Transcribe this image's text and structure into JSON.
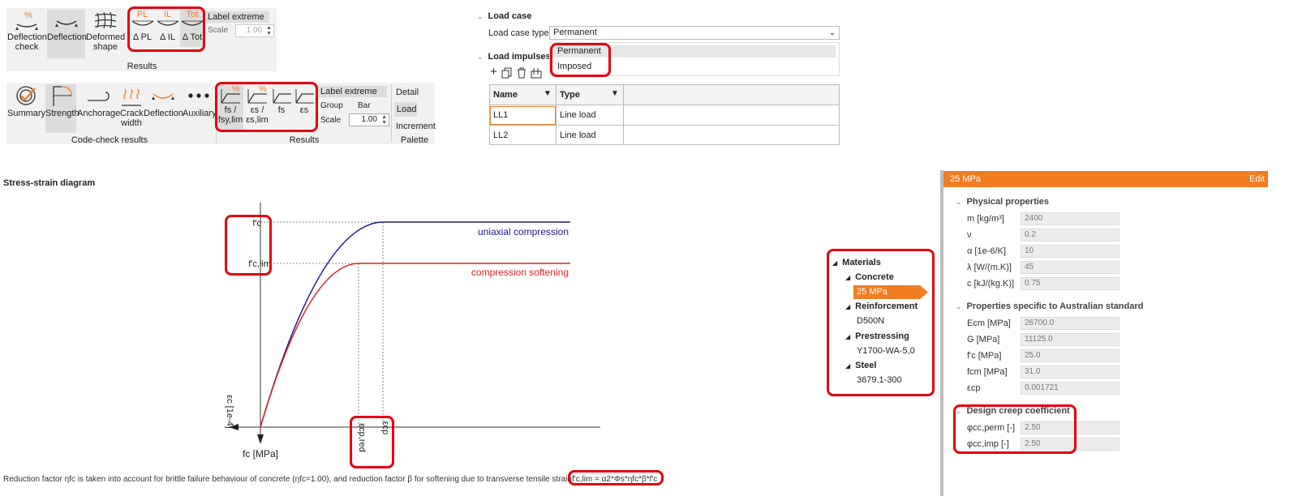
{
  "ribbon1": {
    "buttons": [
      {
        "line1": "Deflection",
        "line2": "check"
      },
      {
        "line1": "Deflection",
        "line2": ""
      },
      {
        "line1": "Deformed",
        "line2": "shape"
      }
    ],
    "icon_tops": [
      "PL",
      "IL",
      "Tot"
    ],
    "icon_labels": [
      "Δ PL",
      "Δ IL",
      "Δ Tot"
    ],
    "label_extreme": "Label extreme",
    "scale_label": "Scale",
    "scale_value": "1.00",
    "group_label": "Results",
    "percent_sign": "%"
  },
  "ribbon2": {
    "buttons": [
      {
        "line1": "Summary",
        "line2": ""
      },
      {
        "line1": "Strength",
        "line2": ""
      },
      {
        "line1": "Anchorage",
        "line2": ""
      },
      {
        "line1": "Crack",
        "line2": "width"
      },
      {
        "line1": "Deflection",
        "line2": ""
      },
      {
        "line1": "Auxiliary",
        "line2": ""
      }
    ],
    "result_buttons": [
      {
        "line1": "fs /",
        "line2": "fsy,lim"
      },
      {
        "line1": "εs /",
        "line2": "εs,lim"
      },
      {
        "line1": "fs",
        "line2": ""
      },
      {
        "line1": "εs",
        "line2": ""
      }
    ],
    "percent_sign": "%",
    "label_extreme": "Label extreme",
    "group_label": "Group",
    "group_value": "Bar",
    "scale_label": "Scale",
    "scale_value": "1.00",
    "detail": "Detail",
    "load": "Load",
    "increment": "Increment",
    "palette": "Palette",
    "codecheck_group": "Code-check results",
    "results_group": "Results"
  },
  "load_panel": {
    "load_case_header": "Load case",
    "load_case_type_label": "Load case type",
    "load_case_type_value": "Permanent",
    "load_impulses_header": "Load impulses",
    "dropdown_options": [
      "Permanent",
      "Imposed"
    ],
    "columns": [
      "Name",
      "Type"
    ],
    "rows": [
      {
        "name": "LL1",
        "type": "Line load"
      },
      {
        "name": "LL2",
        "type": "Line load"
      }
    ]
  },
  "diagram": {
    "title": "Stress-strain diagram",
    "label_fc": "f'c",
    "label_fclim": "f'c,lim",
    "series1_name": "uniaxial compression",
    "series2_name": "compression softening",
    "x_axis_label": "εc [1e-4]",
    "y_axis_label": "fc [MPa]",
    "eps_red": "εcp,red",
    "eps_cp": "εcp",
    "color_series1": "#1a1a8c",
    "color_series2": "#e31d1d",
    "note_text": "Reduction factor ηfc is taken into account for brittle failure behaviour of concrete (ηfc=1.00), and reduction factor β for softening due to transverse tensile strain",
    "formula": "f'c,lim = α2*Φs*ηfc*β*f'c"
  },
  "tree": {
    "root": "Materials",
    "groups": [
      {
        "name": "Concrete",
        "item": "25 MPa"
      },
      {
        "name": "Reinforcement",
        "item": "D500N"
      },
      {
        "name": "Prestressing",
        "item": "Y1700-WA-5,0"
      },
      {
        "name": "Steel",
        "item": "3679.1-300"
      }
    ],
    "selected_color": "#f07d22"
  },
  "properties": {
    "header_title": "25 MPa",
    "edit_label": "Edit",
    "header_color": "#f07d22",
    "physical_header": "Physical properties",
    "physical": [
      {
        "label": "m [kg/m³]",
        "value": "2400"
      },
      {
        "label": "ν",
        "value": "0.2"
      },
      {
        "label": "α [1e-6/K]",
        "value": "10"
      },
      {
        "label": "λ [W/(m.K)]",
        "value": "45"
      },
      {
        "label": "c [kJ/(kg.K)]",
        "value": "0.75"
      }
    ],
    "aus_header": "Properties specific to Australian standard",
    "aus": [
      {
        "label": "Ecm [MPa]",
        "value": "26700.0"
      },
      {
        "label": "G [MPa]",
        "value": "11125.0"
      },
      {
        "label": "f'c [MPa]",
        "value": "25.0"
      },
      {
        "label": "fcm [MPa]",
        "value": "31.0"
      },
      {
        "label": "εcp",
        "value": "0.001721"
      }
    ],
    "creep_header": "Design creep coefficient",
    "creep": [
      {
        "label": "φcc,perm [-]",
        "value": "2.50"
      },
      {
        "label": "φcc,imp [-]",
        "value": "2.50"
      }
    ]
  }
}
